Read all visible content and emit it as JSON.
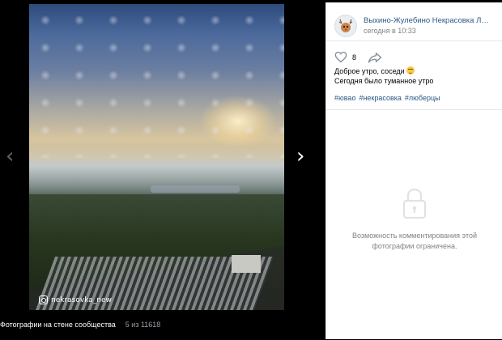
{
  "viewer": {
    "watermark": "nekrasovka_new",
    "footer_label": "Фотографии на стене сообщества",
    "footer_count": "5 из 11618"
  },
  "post": {
    "group_name": "Выхино-Жулебино Некрасовка Лю...",
    "time": "сегодня в 10:33",
    "likes": "8",
    "text_line1": "Доброе утро, соседи",
    "text_line2": "Сегодня было туманное утро",
    "tags": [
      "#ювао",
      "#некрасовка",
      "#люберцы"
    ]
  },
  "comments": {
    "closed_text": "Возможность комментирования этой фотографии ограничена."
  },
  "icons": {
    "prev": "chevron-left-icon",
    "next": "chevron-right-icon",
    "like": "heart-icon",
    "share": "share-arrow-icon",
    "lock": "lock-icon",
    "instagram": "instagram-icon",
    "emoji": "relieved-face-emoji"
  },
  "colors": {
    "link": "#2a5885",
    "muted": "#828282",
    "background": "#000000",
    "panel": "#ffffff"
  }
}
